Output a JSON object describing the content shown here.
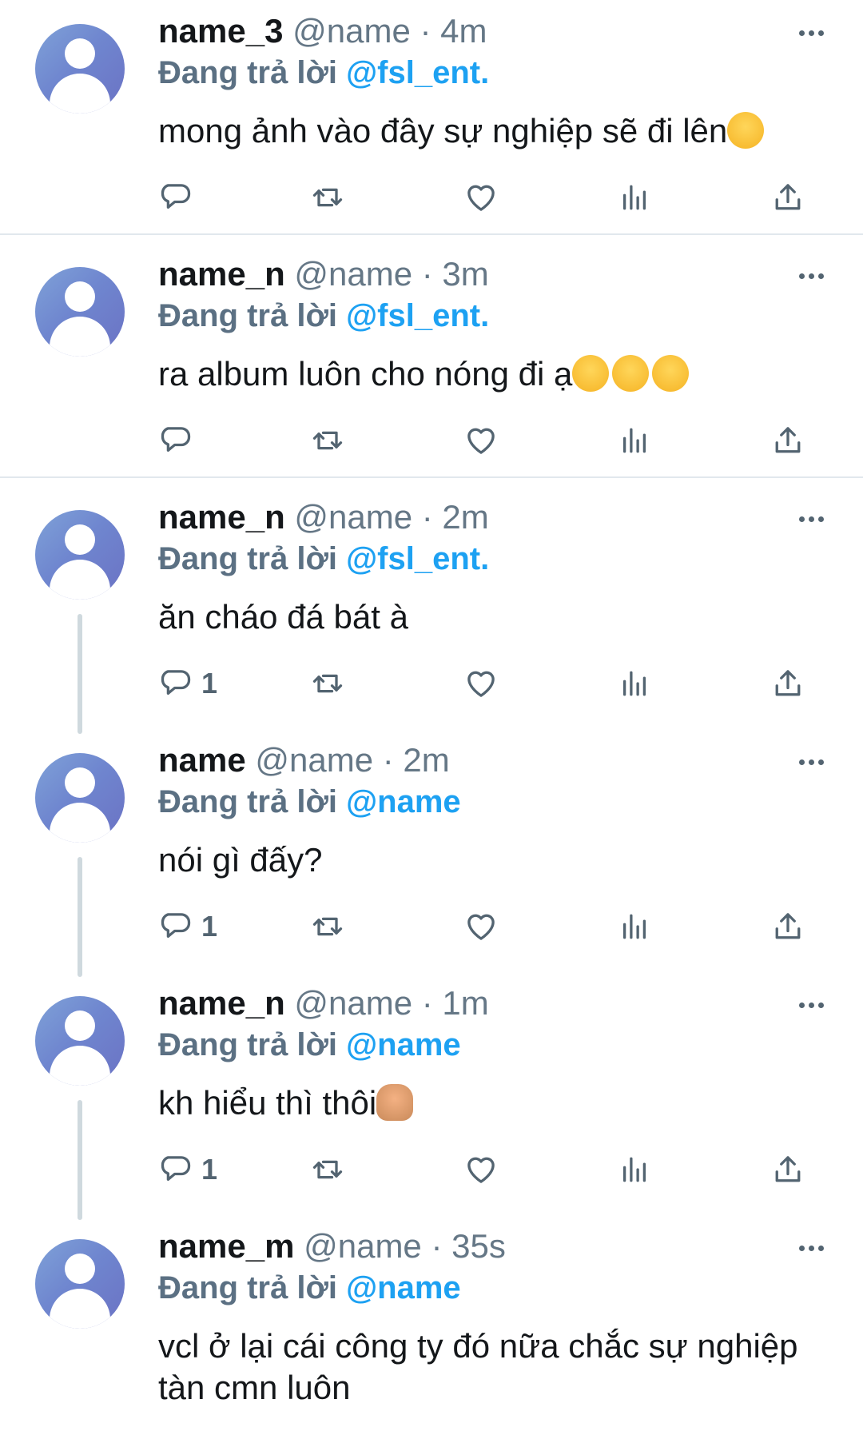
{
  "tweets": [
    {
      "name": "name_3",
      "handle": "@name",
      "time": "· 4m",
      "reply_prefix": "Đang trả lời",
      "mention": "@fsl_ent.",
      "text": "mong ảnh vào đây sự nghiệp sẽ đi lên",
      "emoji": "pleading-face",
      "reply_count": ""
    },
    {
      "name": "name_n",
      "handle": "@name",
      "time": "· 3m",
      "reply_prefix": "Đang trả lời",
      "mention": "@fsl_ent.",
      "text": "ra album luôn cho nóng đi ạ",
      "emoji": "yum-face x3",
      "reply_count": ""
    },
    {
      "name": "name_n",
      "handle": "@name",
      "time": "· 2m",
      "reply_prefix": "Đang trả lời",
      "mention": "@fsl_ent.",
      "text": "ăn cháo đá bát à",
      "emoji": "",
      "reply_count": "1"
    },
    {
      "name": "name",
      "handle": "@name",
      "time": "· 2m",
      "reply_prefix": "Đang trả lời",
      "mention": "@name",
      "text": "nói gì đấy?",
      "emoji": "",
      "reply_count": "1"
    },
    {
      "name": "name_n",
      "handle": "@name",
      "time": "· 1m",
      "reply_prefix": "Đang trả lời",
      "mention": "@name",
      "text": "kh hiểu thì thôi",
      "emoji": "person-shrugging",
      "reply_count": "1"
    },
    {
      "name": "name_m",
      "handle": "@name",
      "time": "· 35s",
      "reply_prefix": "Đang trả lời",
      "mention": "@name",
      "text": "vcl ở lại cái công ty đó nữa chắc sự nghiệp tàn cmn luôn",
      "emoji": "",
      "reply_count": ""
    }
  ],
  "icons": {
    "reply": "reply-icon",
    "retweet": "retweet-icon",
    "like": "like-icon",
    "analytics": "analytics-icon",
    "share": "share-icon",
    "more": "more-icon"
  },
  "colors": {
    "mention": "#1da1f2",
    "muted": "#536471",
    "divider": "#e1e8ed"
  }
}
